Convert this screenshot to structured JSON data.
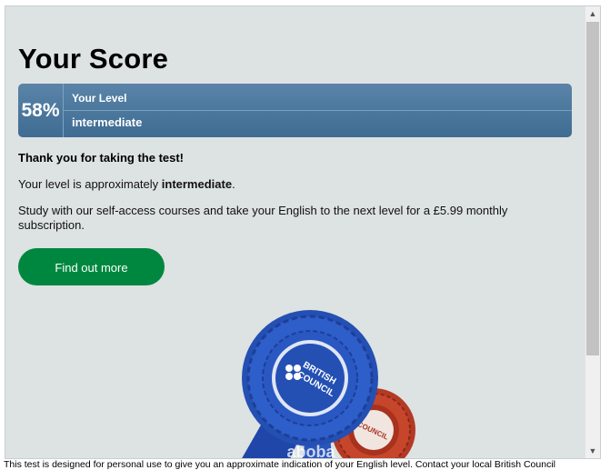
{
  "title": "Your Score",
  "score": {
    "percent": "58%",
    "level_label": "Your Level",
    "level_value": "intermediate"
  },
  "thanks": "Thank you for taking the test!",
  "level_sentence": {
    "prefix": "Your level is approximately ",
    "level": "intermediate",
    "suffix": "."
  },
  "study_text": "Study with our self-access courses and take your English to the next level for a £5.99 monthly subscription.",
  "cta_label": "Find out more",
  "rosette": {
    "front_text_1": "BRITISH",
    "front_text_2": "COUNCIL",
    "back_text": "COUNCIL",
    "watermark": "aboba"
  },
  "footer_text": "This test is designed for personal use to give you an approximate indication of your English level. Contact your local British Council",
  "scrollbar": {
    "up_icon": "▲",
    "down_icon": "▼"
  },
  "colors": {
    "score_bar": "#4a76a0",
    "cta": "#00873f",
    "background": "#dde2e2"
  }
}
